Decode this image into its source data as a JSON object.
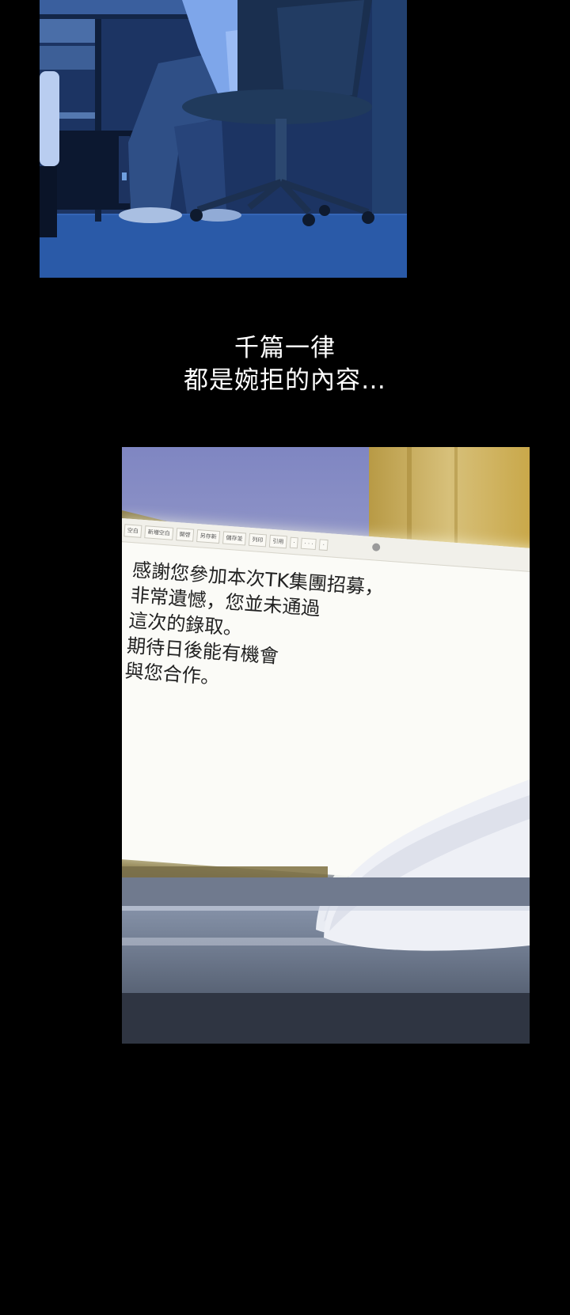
{
  "panel1": {
    "label": "office-night-scene"
  },
  "caption": {
    "line1": "千篇一律",
    "line2": "都是婉拒的內容…"
  },
  "laptop": {
    "toolbar": [
      "空白",
      "新増空白",
      "開啓",
      "另存新",
      "儲存並",
      "列印",
      "引用",
      "·",
      "·  ·  ·",
      "·"
    ],
    "message": [
      "感謝您參加本次TK集團招募，",
      "非常遺憾，您並未通過",
      "這次的錄取。",
      "期待日後能有機會",
      "與您合作。"
    ]
  },
  "colors": {
    "background": "#000000",
    "night_blue": "#1f3a6e",
    "screen_white": "#fbfbf7",
    "wall_gold": "#c9a84a"
  }
}
